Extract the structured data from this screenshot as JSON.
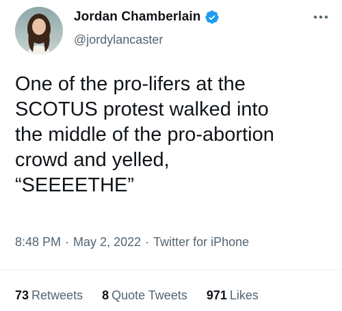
{
  "tweet": {
    "author": {
      "name": "Jordan Chamberlain",
      "handle": "@jordylancaster",
      "verified_icon": "verified-badge-icon",
      "avatar_icon": "avatar-photo"
    },
    "text": "One of the pro-lifers at the\nSCOTUS protest walked into\nthe middle of the pro-abortion\ncrowd and yelled,\n“SEEEETHE”",
    "time": "8:48 PM",
    "date": "May 2, 2022",
    "source": "Twitter for iPhone",
    "separator": "·",
    "stats": [
      {
        "count": "73",
        "label": "Retweets"
      },
      {
        "count": "8",
        "label": "Quote Tweets"
      },
      {
        "count": "971",
        "label": "Likes"
      }
    ]
  },
  "colors": {
    "accent": "#1d9bf0",
    "text_primary": "#0f1419",
    "text_secondary": "#536471",
    "divider": "#eff3f4"
  }
}
